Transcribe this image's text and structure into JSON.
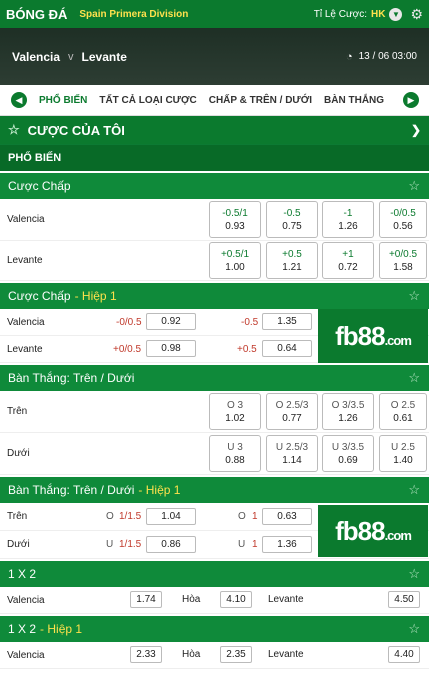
{
  "header": {
    "title": "BÓNG ĐÁ",
    "league": "Spain Primera Division",
    "odds_label": "Tỉ Lệ Cược:",
    "odds_value": "HK"
  },
  "match": {
    "home": "Valencia",
    "vs": "v",
    "away": "Levante",
    "datetime": "13 / 06  03:00"
  },
  "tabs": [
    {
      "label": "PHỔ BIẾN"
    },
    {
      "label": "TẤT CẢ LOẠI CƯỢC"
    },
    {
      "label": "CHẤP & TRÊN / DƯỚI"
    },
    {
      "label": "BÀN THẮNG"
    }
  ],
  "my_bets": "CƯỢC CỦA TÔI",
  "popular": "PHỔ BIẾN",
  "handicap": {
    "title": "Cược Chấp",
    "rows": [
      {
        "team": "Valencia",
        "cells": [
          {
            "line": "-0.5/1",
            "odds": "0.93"
          },
          {
            "line": "-0.5",
            "odds": "0.75"
          },
          {
            "line": "-1",
            "odds": "1.26"
          },
          {
            "line": "-0/0.5",
            "odds": "0.56"
          }
        ]
      },
      {
        "team": "Levante",
        "cells": [
          {
            "line": "+0.5/1",
            "odds": "1.00"
          },
          {
            "line": "+0.5",
            "odds": "1.21"
          },
          {
            "line": "+1",
            "odds": "0.72"
          },
          {
            "line": "+0/0.5",
            "odds": "1.58"
          }
        ]
      }
    ]
  },
  "handicap_h1": {
    "title": "Cược Chấp",
    "half": "- Hiệp 1",
    "rows": [
      {
        "team": "Valencia",
        "l1": "-0/0.5",
        "o1": "0.92",
        "l2": "-0.5",
        "o2": "1.35"
      },
      {
        "team": "Levante",
        "l1": "+0/0.5",
        "o1": "0.98",
        "l2": "+0.5",
        "o2": "0.64"
      }
    ]
  },
  "banner": {
    "fb": "fb",
    "num": "88",
    "dom": ".com"
  },
  "ou": {
    "title": "Bàn Thắng: Trên / Dưới",
    "rows": [
      {
        "label": "Trên",
        "cells": [
          {
            "line": "O 3",
            "odds": "1.02"
          },
          {
            "line": "O 2.5/3",
            "odds": "0.77"
          },
          {
            "line": "O 3/3.5",
            "odds": "1.26"
          },
          {
            "line": "O 2.5",
            "odds": "0.61"
          }
        ]
      },
      {
        "label": "Dưới",
        "cells": [
          {
            "line": "U 3",
            "odds": "0.88"
          },
          {
            "line": "U 2.5/3",
            "odds": "1.14"
          },
          {
            "line": "U 3/3.5",
            "odds": "0.69"
          },
          {
            "line": "U 2.5",
            "odds": "1.40"
          }
        ]
      }
    ]
  },
  "ou_h1": {
    "title": "Bàn Thắng: Trên / Dưới",
    "half": "- Hiệp 1",
    "rows": [
      {
        "label": "Trên",
        "p1": "O",
        "l1": "1/1.5",
        "o1": "1.04",
        "p2": "O",
        "l2": "1",
        "o2": "0.63"
      },
      {
        "label": "Dưới",
        "p1": "U",
        "l1": "1/1.5",
        "o1": "0.86",
        "p2": "U",
        "l2": "1",
        "o2": "1.36"
      }
    ]
  },
  "x12": {
    "title": "1 X 2",
    "home": "Valencia",
    "home_odds": "1.74",
    "draw": "Hòa",
    "draw_odds": "4.10",
    "away": "Levante",
    "away_odds": "4.50"
  },
  "x12_h1": {
    "title": "1 X 2",
    "half": "- Hiệp 1",
    "home": "Valencia",
    "home_odds": "2.33",
    "draw": "Hòa",
    "draw_odds": "2.35",
    "away": "Levante",
    "away_odds": "4.40"
  }
}
